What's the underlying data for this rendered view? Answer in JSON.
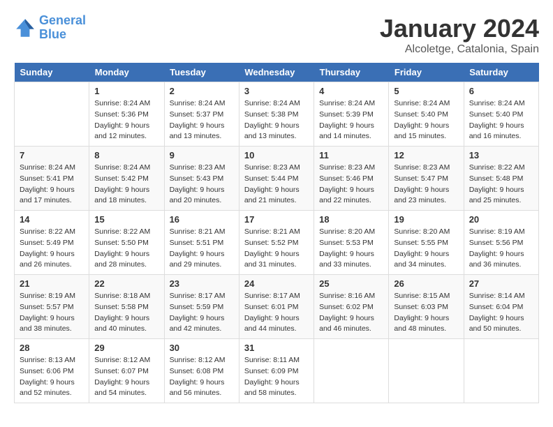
{
  "header": {
    "logo_line1": "General",
    "logo_line2": "Blue",
    "month": "January 2024",
    "location": "Alcoletge, Catalonia, Spain"
  },
  "days_of_week": [
    "Sunday",
    "Monday",
    "Tuesday",
    "Wednesday",
    "Thursday",
    "Friday",
    "Saturday"
  ],
  "weeks": [
    [
      {
        "day": "",
        "detail": ""
      },
      {
        "day": "1",
        "detail": "Sunrise: 8:24 AM\nSunset: 5:36 PM\nDaylight: 9 hours\nand 12 minutes."
      },
      {
        "day": "2",
        "detail": "Sunrise: 8:24 AM\nSunset: 5:37 PM\nDaylight: 9 hours\nand 13 minutes."
      },
      {
        "day": "3",
        "detail": "Sunrise: 8:24 AM\nSunset: 5:38 PM\nDaylight: 9 hours\nand 13 minutes."
      },
      {
        "day": "4",
        "detail": "Sunrise: 8:24 AM\nSunset: 5:39 PM\nDaylight: 9 hours\nand 14 minutes."
      },
      {
        "day": "5",
        "detail": "Sunrise: 8:24 AM\nSunset: 5:40 PM\nDaylight: 9 hours\nand 15 minutes."
      },
      {
        "day": "6",
        "detail": "Sunrise: 8:24 AM\nSunset: 5:40 PM\nDaylight: 9 hours\nand 16 minutes."
      }
    ],
    [
      {
        "day": "7",
        "detail": ""
      },
      {
        "day": "8",
        "detail": "Sunrise: 8:24 AM\nSunset: 5:42 PM\nDaylight: 9 hours\nand 18 minutes."
      },
      {
        "day": "9",
        "detail": "Sunrise: 8:23 AM\nSunset: 5:43 PM\nDaylight: 9 hours\nand 20 minutes."
      },
      {
        "day": "10",
        "detail": "Sunrise: 8:23 AM\nSunset: 5:44 PM\nDaylight: 9 hours\nand 21 minutes."
      },
      {
        "day": "11",
        "detail": "Sunrise: 8:23 AM\nSunset: 5:46 PM\nDaylight: 9 hours\nand 22 minutes."
      },
      {
        "day": "12",
        "detail": "Sunrise: 8:23 AM\nSunset: 5:47 PM\nDaylight: 9 hours\nand 23 minutes."
      },
      {
        "day": "13",
        "detail": "Sunrise: 8:22 AM\nSunset: 5:48 PM\nDaylight: 9 hours\nand 25 minutes."
      }
    ],
    [
      {
        "day": "14",
        "detail": "Sunrise: 8:22 AM\nSunset: 5:49 PM\nDaylight: 9 hours\nand 26 minutes."
      },
      {
        "day": "15",
        "detail": "Sunrise: 8:22 AM\nSunset: 5:50 PM\nDaylight: 9 hours\nand 28 minutes."
      },
      {
        "day": "16",
        "detail": "Sunrise: 8:21 AM\nSunset: 5:51 PM\nDaylight: 9 hours\nand 29 minutes."
      },
      {
        "day": "17",
        "detail": "Sunrise: 8:21 AM\nSunset: 5:52 PM\nDaylight: 9 hours\nand 31 minutes."
      },
      {
        "day": "18",
        "detail": "Sunrise: 8:20 AM\nSunset: 5:53 PM\nDaylight: 9 hours\nand 33 minutes."
      },
      {
        "day": "19",
        "detail": "Sunrise: 8:20 AM\nSunset: 5:55 PM\nDaylight: 9 hours\nand 34 minutes."
      },
      {
        "day": "20",
        "detail": "Sunrise: 8:19 AM\nSunset: 5:56 PM\nDaylight: 9 hours\nand 36 minutes."
      }
    ],
    [
      {
        "day": "21",
        "detail": "Sunrise: 8:19 AM\nSunset: 5:57 PM\nDaylight: 9 hours\nand 38 minutes."
      },
      {
        "day": "22",
        "detail": "Sunrise: 8:18 AM\nSunset: 5:58 PM\nDaylight: 9 hours\nand 40 minutes."
      },
      {
        "day": "23",
        "detail": "Sunrise: 8:17 AM\nSunset: 5:59 PM\nDaylight: 9 hours\nand 42 minutes."
      },
      {
        "day": "24",
        "detail": "Sunrise: 8:17 AM\nSunset: 6:01 PM\nDaylight: 9 hours\nand 44 minutes."
      },
      {
        "day": "25",
        "detail": "Sunrise: 8:16 AM\nSunset: 6:02 PM\nDaylight: 9 hours\nand 46 minutes."
      },
      {
        "day": "26",
        "detail": "Sunrise: 8:15 AM\nSunset: 6:03 PM\nDaylight: 9 hours\nand 48 minutes."
      },
      {
        "day": "27",
        "detail": "Sunrise: 8:14 AM\nSunset: 6:04 PM\nDaylight: 9 hours\nand 50 minutes."
      }
    ],
    [
      {
        "day": "28",
        "detail": "Sunrise: 8:13 AM\nSunset: 6:06 PM\nDaylight: 9 hours\nand 52 minutes."
      },
      {
        "day": "29",
        "detail": "Sunrise: 8:12 AM\nSunset: 6:07 PM\nDaylight: 9 hours\nand 54 minutes."
      },
      {
        "day": "30",
        "detail": "Sunrise: 8:12 AM\nSunset: 6:08 PM\nDaylight: 9 hours\nand 56 minutes."
      },
      {
        "day": "31",
        "detail": "Sunrise: 8:11 AM\nSunset: 6:09 PM\nDaylight: 9 hours\nand 58 minutes."
      },
      {
        "day": "",
        "detail": ""
      },
      {
        "day": "",
        "detail": ""
      },
      {
        "day": "",
        "detail": ""
      }
    ]
  ],
  "week7_sunday": "Sunrise: 8:24 AM\nSunset: 5:41 PM\nDaylight: 9 hours\nand 17 minutes."
}
